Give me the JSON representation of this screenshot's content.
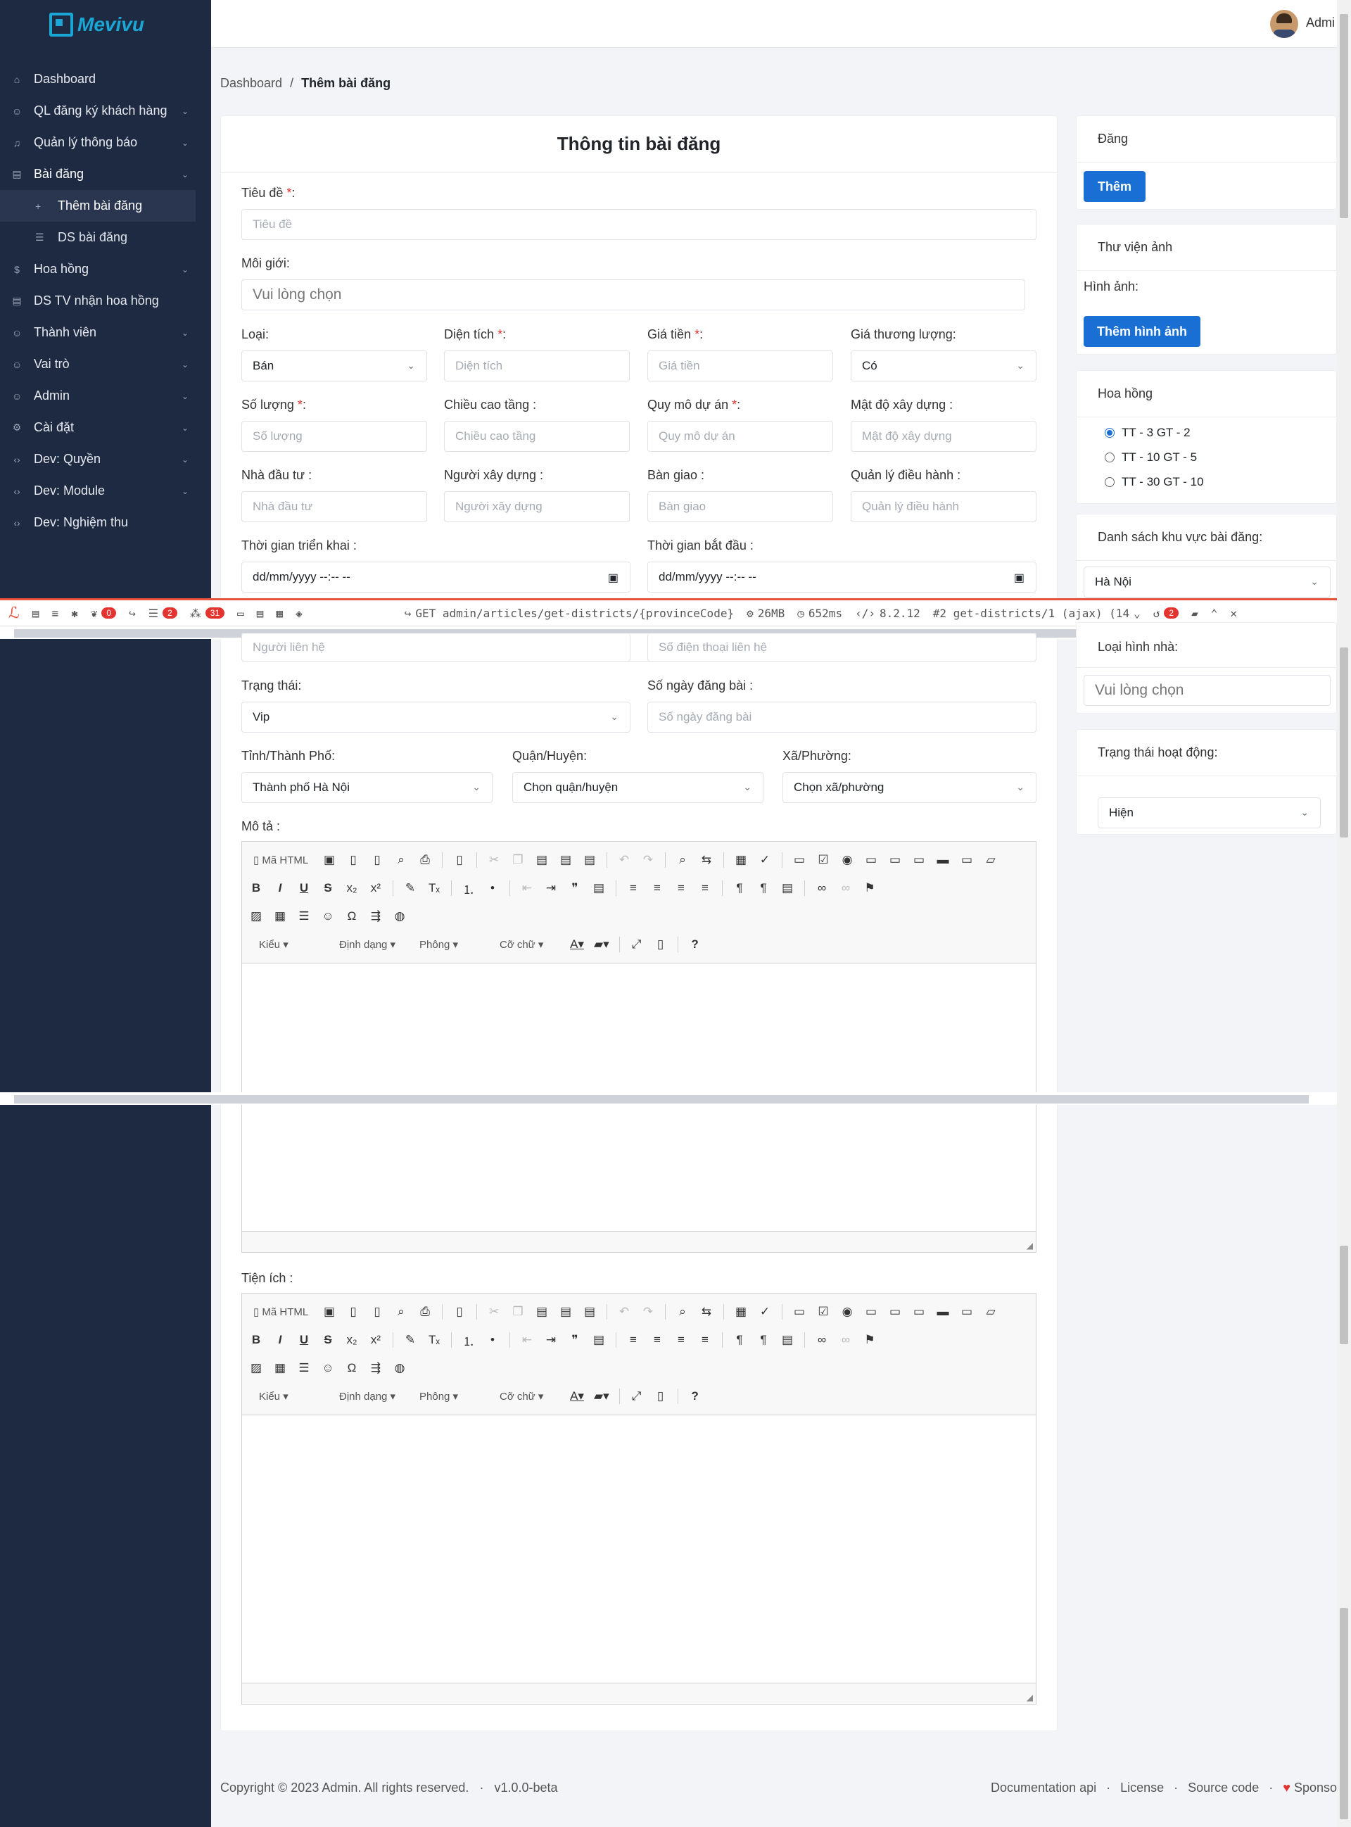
{
  "brand": {
    "name": "Mevivu"
  },
  "user": {
    "name": "Admi"
  },
  "sidebar": {
    "items": [
      {
        "label": "Dashboard",
        "icon": "home-icon"
      },
      {
        "label": "QL đăng ký khách hàng",
        "icon": "users-icon"
      },
      {
        "label": "Quản lý thông báo",
        "icon": "bell-icon"
      },
      {
        "label": "Bài đăng",
        "icon": "article-icon"
      },
      {
        "label": "Thêm bài đăng",
        "icon": "plus-icon"
      },
      {
        "label": "DS bài đăng",
        "icon": "list-icon"
      },
      {
        "label": "Hoa hồng",
        "icon": "dollar-icon"
      },
      {
        "label": "DS TV nhận hoa hồng",
        "icon": "list-icon"
      },
      {
        "label": "Thành viên",
        "icon": "users-icon"
      },
      {
        "label": "Vai trò",
        "icon": "user-check-icon"
      },
      {
        "label": "Admin",
        "icon": "user-icon"
      },
      {
        "label": "Cài đặt",
        "icon": "gear-icon"
      },
      {
        "label": "Dev: Quyền",
        "icon": "code-icon"
      },
      {
        "label": "Dev: Module",
        "icon": "code-icon"
      },
      {
        "label": "Dev: Nghiệm thu",
        "icon": "code-icon"
      }
    ]
  },
  "breadcrumb": {
    "home": "Dashboard",
    "sep": "/",
    "current": "Thêm bài đăng"
  },
  "form": {
    "title": "Thông tin bài đăng",
    "title_label": "Tiêu đề",
    "title_ph": "Tiêu đề",
    "broker_label": "Môi giới:",
    "broker_ph": "Vui lòng chọn",
    "type_label": "Loại:",
    "type_val": "Bán",
    "area_label": "Diện tích",
    "area_ph": "Diện tích",
    "price_label": "Giá tiền",
    "price_ph": "Giá tiền",
    "nego_label": "Giá thương lượng:",
    "nego_val": "Có",
    "qty_label": "Số lượng",
    "qty_ph": "Số lượng",
    "height_label": "Chiều cao tầng :",
    "height_ph": "Chiều cao tầng",
    "scale_label": "Quy mô dự án",
    "scale_ph": "Quy mô dự án",
    "density_label": "Mật độ xây dựng :",
    "density_ph": "Mật độ xây dựng",
    "investor_label": "Nhà đầu tư :",
    "investor_ph": "Nhà đầu tư",
    "builder_label": "Người xây dựng :",
    "builder_ph": "Người xây dựng",
    "handover_label": "Bàn giao :",
    "handover_ph": "Bàn giao",
    "operator_label": "Quản lý điều hành :",
    "operator_ph": "Quản lý điều hành",
    "deploy_label": "Thời gian triển khai :",
    "deploy_val": "dd/mm/yyyy --:-- --",
    "start_label": "Thời gian bắt đầu :",
    "start_val": "dd/mm/yyyy --:-- --",
    "contact_ph": "Người liên hệ",
    "phone_ph": "Số điện thoại liên hệ",
    "status_label": "Trạng thái:",
    "status_val": "Vip",
    "days_label": "Số ngày đăng bài :",
    "days_ph": "Số ngày đăng bài",
    "province_label": "Tỉnh/Thành Phố:",
    "province_val": "Thành phố Hà Nội",
    "district_label": "Quận/Huyện:",
    "district_val": "Chọn quận/huyện",
    "ward_label": "Xã/Phường:",
    "ward_val": "Chọn xã/phường",
    "desc_label": "Mô tả :",
    "util_label": "Tiện ích :",
    "req_mark": "*",
    "colon": ":"
  },
  "editor": {
    "source": "Mã HTML",
    "style": "Kiểu",
    "format": "Định dạng",
    "font": "Phông",
    "size": "Cỡ chữ",
    "help": "?"
  },
  "right": {
    "publish_title": "Đăng",
    "publish_btn": "Thêm",
    "gallery_title": "Thư viện ảnh",
    "gallery_label": "Hình ảnh:",
    "gallery_btn": "Thêm hình ảnh",
    "commission_title": "Hoa hồng",
    "commission_opts": [
      "TT - 3 GT - 2",
      "TT - 10 GT - 5",
      "TT - 30 GT - 10"
    ],
    "area_title": "Danh sách khu vực bài đăng:",
    "area_val": "Hà Nội",
    "house_title": "Loại hình nhà:",
    "house_ph": "Vui lòng chọn",
    "active_title": "Trạng thái hoạt động:",
    "active_val": "Hiện"
  },
  "debugbar": {
    "b_exc": "0",
    "b_q": "2",
    "b_views": "31",
    "route": "GET admin/articles/get-districts/{provinceCode}",
    "mem": "26MB",
    "time": "652ms",
    "php": "8.2.12",
    "req": "#2 get-districts/1 (ajax) (14",
    "b_hist": "2"
  },
  "footer": {
    "copy": "Copyright © 2023 Admin. All rights reserved.",
    "version": "v1.0.0-beta",
    "docs": "Documentation api",
    "license": "License",
    "source": "Source code",
    "sponsor": "Sponso",
    "dot": "·"
  }
}
